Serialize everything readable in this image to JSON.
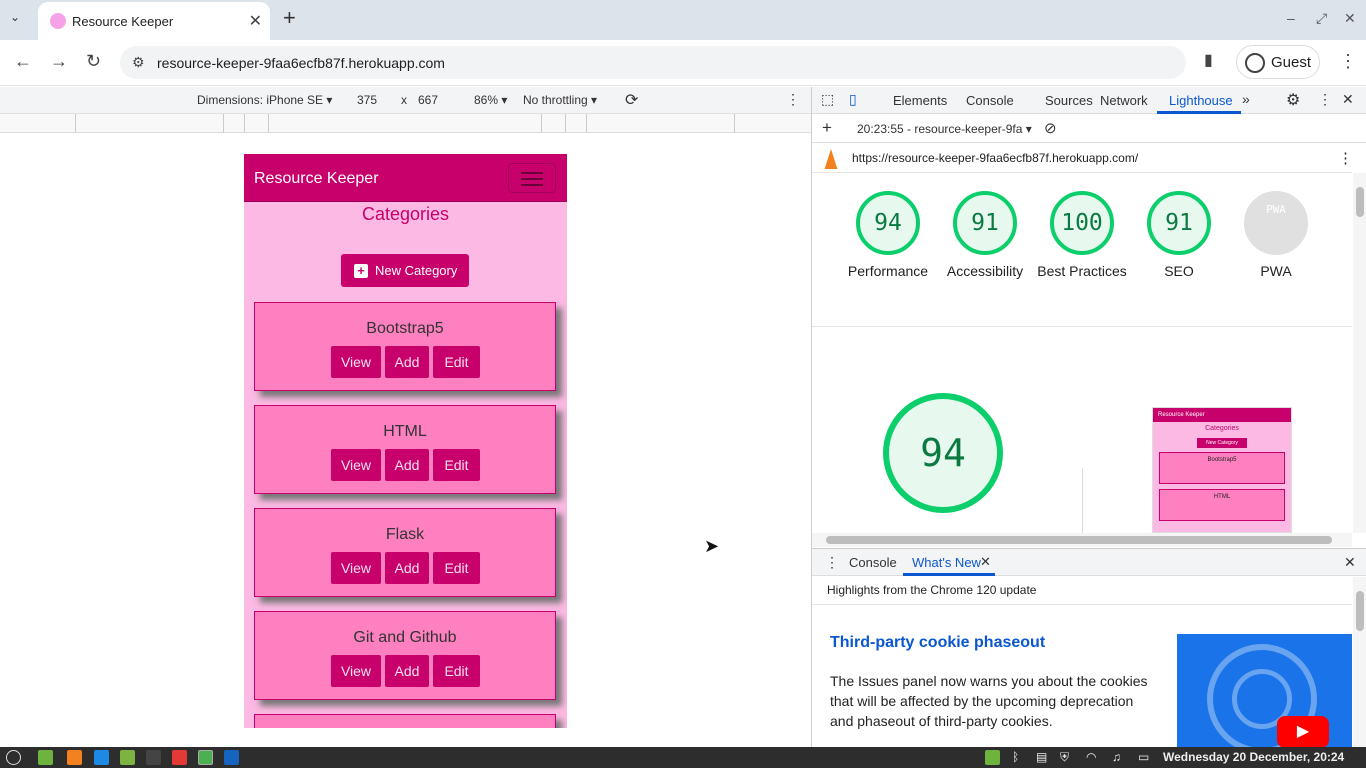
{
  "browser": {
    "tab_title": "Resource Keeper",
    "url": "resource-keeper-9faa6ecfb87f.herokuapp.com",
    "profile_label": "Guest"
  },
  "device_toolbar": {
    "dimensions": "Dimensions: iPhone SE",
    "width": "375",
    "times": "x",
    "height": "667",
    "zoom": "86%",
    "throttling": "No throttling"
  },
  "site": {
    "brand": "Resource Keeper",
    "heading": "Categories",
    "new_category": "New Category",
    "categories": [
      {
        "name": "Bootstrap5",
        "view": "View",
        "add": "Add",
        "edit": "Edit"
      },
      {
        "name": "HTML",
        "view": "View",
        "add": "Add",
        "edit": "Edit"
      },
      {
        "name": "Flask",
        "view": "View",
        "add": "Add",
        "edit": "Edit"
      },
      {
        "name": "Git and Github",
        "view": "View",
        "add": "Add",
        "edit": "Edit"
      }
    ]
  },
  "devtools": {
    "tabs": [
      "Elements",
      "Console",
      "Sources",
      "Network",
      "Lighthouse"
    ],
    "active_tab": "Lighthouse",
    "report_selector": "20:23:55 - resource-keeper-9fa",
    "report_url": "https://resource-keeper-9faa6ecfb87f.herokuapp.com/",
    "scores": [
      {
        "value": "94",
        "label": "Performance"
      },
      {
        "value": "91",
        "label": "Accessibility"
      },
      {
        "value": "100",
        "label": "Best Practices"
      },
      {
        "value": "91",
        "label": "SEO"
      },
      {
        "value": "PWA",
        "label": "PWA"
      }
    ],
    "performance_score": "94",
    "thumbnail": {
      "brand": "Resource Keeper",
      "heading": "Categories",
      "new_category": "New Category",
      "items": [
        "Bootstrap5",
        "HTML"
      ]
    }
  },
  "drawer": {
    "tabs": [
      "Console",
      "What's New"
    ],
    "active_tab": "What's New",
    "subtitle": "Highlights from the Chrome 120 update",
    "article_title": "Third-party cookie phaseout",
    "article_text": "The Issues panel now warns you about the cookies that will be affected by the upcoming deprecation and phaseout of third-party cookies."
  },
  "taskbar": {
    "datetime": "Wednesday 20 December, 20:24"
  },
  "colors": {
    "brand": "#c7006b",
    "card": "#fe80c0",
    "page_bg": "#fcb9e3",
    "lighthouse_good": "#0cce6b",
    "devtools_accent": "#0b57d0"
  }
}
